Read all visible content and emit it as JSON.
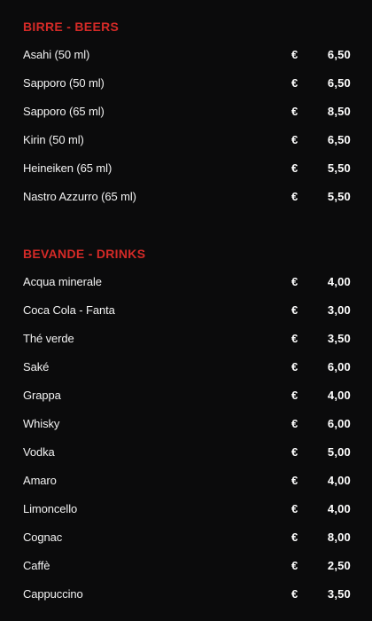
{
  "sections": {
    "beers": {
      "title": "BIRRE - BEERS",
      "items": [
        {
          "name": "Asahi (50 ml)",
          "currency": "€",
          "price": "6,50"
        },
        {
          "name": "Sapporo (50 ml)",
          "currency": "€",
          "price": "6,50"
        },
        {
          "name": "Sapporo (65 ml)",
          "currency": "€",
          "price": "8,50"
        },
        {
          "name": "Kirin (50 ml)",
          "currency": "€",
          "price": "6,50"
        },
        {
          "name": "Heineiken (65 ml)",
          "currency": "€",
          "price": "5,50"
        },
        {
          "name": "Nastro Azzurro (65 ml)",
          "currency": "€",
          "price": "5,50"
        }
      ]
    },
    "drinks": {
      "title": "BEVANDE - DRINKS",
      "items": [
        {
          "name": "Acqua minerale",
          "currency": "€",
          "price": "4,00"
        },
        {
          "name": "Coca Cola - Fanta",
          "currency": "€",
          "price": "3,00"
        },
        {
          "name": "Thé verde",
          "currency": "€",
          "price": "3,50"
        },
        {
          "name": "Saké",
          "currency": "€",
          "price": "6,00"
        },
        {
          "name": "Grappa",
          "currency": "€",
          "price": "4,00"
        },
        {
          "name": "Whisky",
          "currency": "€",
          "price": "6,00"
        },
        {
          "name": "Vodka",
          "currency": "€",
          "price": "5,00"
        },
        {
          "name": "Amaro",
          "currency": "€",
          "price": "4,00"
        },
        {
          "name": "Limoncello",
          "currency": "€",
          "price": "4,00"
        },
        {
          "name": "Cognac",
          "currency": "€",
          "price": "8,00"
        },
        {
          "name": "Caffè",
          "currency": "€",
          "price": "2,50"
        },
        {
          "name": "Cappuccino",
          "currency": "€",
          "price": "3,50"
        }
      ]
    }
  },
  "colors": {
    "background": "#0b0b0c",
    "section_title": "#d42a27",
    "text": "#f2f2f2"
  }
}
